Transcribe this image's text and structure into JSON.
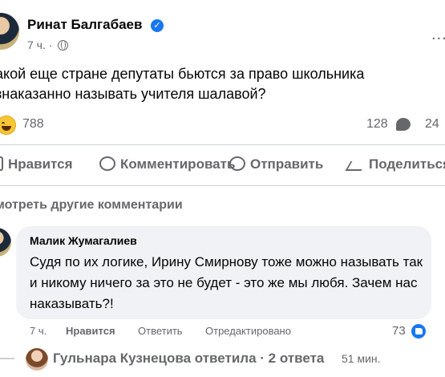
{
  "post": {
    "author": "Ринат Балгабаев",
    "time": "7 ч. ·",
    "more": "...",
    "text_line1": "акой еще стране депутаты бьются за право школьника",
    "text_line2": "знаказанно называть учителя шалавой?",
    "reaction_count": "788",
    "comment_count": "128",
    "share_count": "24"
  },
  "actions": {
    "like": "Нравится",
    "comment": "Комментировать",
    "send": "Отправить",
    "share": "Поделиться"
  },
  "comments": {
    "view_more": "мотреть другие комментарии",
    "items": [
      {
        "author": "Малик Жумагалиев",
        "text": "Судя по их логике, Ирину Смирнову тоже можно называть так и никому ничего за это не будет - это же мы любя. Зачем нас наказывать?!",
        "time": "7 ч.",
        "like": "Нравится",
        "reply": "Ответить",
        "edited": "Отредактировано",
        "likes": "73"
      }
    ],
    "reply_summary": {
      "text": "Гульнара Кузнецова ответила · 2 ответа",
      "time": "51 мин."
    }
  },
  "colors": {
    "accent": "#1877f2",
    "muted_text": "#65676b",
    "bubble_bg": "#f0f2f5"
  }
}
